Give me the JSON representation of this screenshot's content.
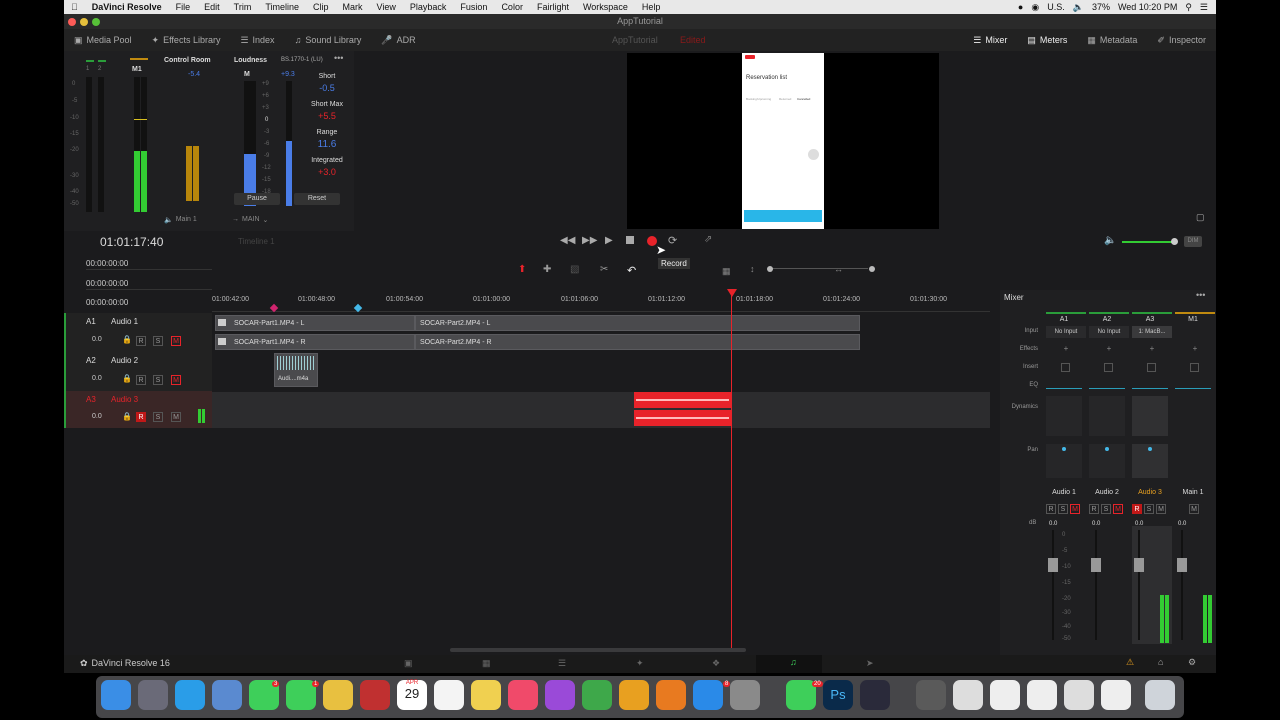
{
  "menubar": {
    "app_name": "DaVinci Resolve",
    "items": [
      "File",
      "Edit",
      "Trim",
      "Timeline",
      "Clip",
      "Mark",
      "View",
      "Playback",
      "Fusion",
      "Color",
      "Fairlight",
      "Workspace",
      "Help"
    ],
    "locale": "U.S.",
    "battery": "37%",
    "clock": "Wed 10:20 PM"
  },
  "window": {
    "title": "AppTutorial"
  },
  "toolbar": {
    "left": [
      "Media Pool",
      "Effects Library",
      "Index",
      "Sound Library",
      "ADR"
    ],
    "center_title": "AppTutorial",
    "center_status": "Edited",
    "right": [
      "Mixer",
      "Meters",
      "Metadata",
      "Inspector"
    ]
  },
  "meters": {
    "control_room": "Control Room",
    "m1": "M1",
    "m1_value": "-5.4",
    "loudness": "Loudness",
    "loudness_std": "BS.1770-1 (LU)",
    "m_label": "M",
    "m_value": "+9.3",
    "short_label": "Short",
    "short_value": "-0.5",
    "short_max_label": "Short Max",
    "short_max_value": "+5.5",
    "range_label": "Range",
    "range_value": "11.6",
    "integrated_label": "Integrated",
    "integrated_value": "+3.0",
    "pause": "Pause",
    "reset": "Reset",
    "main1": "Main 1",
    "main": "MAIN",
    "scale_left": [
      "0",
      "-5",
      "-10",
      "-15",
      "-20",
      "-30",
      "-40",
      "-50"
    ],
    "scale_loud": [
      "+9",
      "+6",
      "+3",
      "0",
      "-3",
      "-6",
      "-9",
      "-12",
      "-15",
      "-18"
    ],
    "ch_nums": [
      "1",
      "2"
    ]
  },
  "phone": {
    "title": "Reservation list",
    "tabs": [
      "Booking/Upcoming",
      "Returned",
      "Cancelled"
    ]
  },
  "transport": {
    "timecode": "01:01:17:40",
    "timeline_name": "Timeline 1",
    "tooltip": "Record"
  },
  "timecodes": [
    "00:00:00:00",
    "00:00:00:00",
    "00:00:00:00"
  ],
  "ruler": [
    "01:00:42:00",
    "01:00:48:00",
    "01:00:54:00",
    "01:01:00:00",
    "01:01:06:00",
    "01:01:12:00",
    "01:01:18:00",
    "01:01:24:00",
    "01:01:30:00"
  ],
  "tracks": [
    {
      "id": "A1",
      "name": "Audio 1",
      "vol": "0.0"
    },
    {
      "id": "A2",
      "name": "Audio 2",
      "vol": "0.0"
    },
    {
      "id": "A3",
      "name": "Audio 3",
      "vol": "0.0"
    }
  ],
  "rsm": [
    "R",
    "S",
    "M"
  ],
  "clips": {
    "a1_top_left": "SOCAR-Part1.MP4 - L",
    "a1_top_right": "SOCAR-Part2.MP4 - L",
    "a1_bot_left": "SOCAR-Part1.MP4 - R",
    "a1_bot_right": "SOCAR-Part2.MP4 - R",
    "a2": "Audi....m4a"
  },
  "mixer": {
    "title": "Mixer",
    "columns": [
      "A1",
      "A2",
      "A3",
      "M1"
    ],
    "rows": [
      "Input",
      "Effects",
      "Insert",
      "EQ",
      "Dynamics",
      "Pan"
    ],
    "inputs": [
      "No Input",
      "No Input",
      "1: MacB..."
    ],
    "names": [
      "Audio 1",
      "Audio 2",
      "Audio 3",
      "Main 1"
    ],
    "vals": [
      "0.0",
      "0.0",
      "0.0",
      "0.0"
    ],
    "db": "dB",
    "fader_scale": [
      "0",
      "-5",
      "-10",
      "-15",
      "-20",
      "-30",
      "-40",
      "-50"
    ]
  },
  "status": {
    "app": "DaVinci Resolve 16"
  },
  "dock": {
    "date_month": "APR",
    "date_day": "29",
    "badge_mail": "3",
    "badge_cal": "1",
    "badge_appstore": "8",
    "badge_whatsapp": "20"
  },
  "colors": {
    "accent_red": "#e8232a",
    "meter_green": "#33cc33",
    "loud_blue": "#4a7de8",
    "amber": "#c08a10"
  }
}
